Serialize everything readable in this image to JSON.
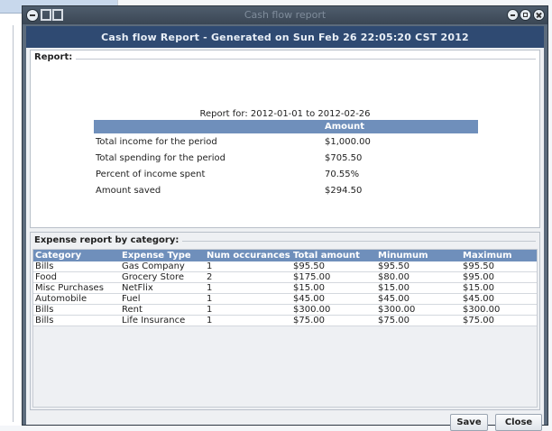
{
  "window": {
    "title": "Cash flow report",
    "header": "Cash flow Report - Generated on Sun Feb 26 22:05:20 CST 2012"
  },
  "report": {
    "legend": "Report:",
    "period": "Report for: 2012-01-01 to 2012-02-26",
    "amount_header": "Amount",
    "rows": [
      {
        "label": "Total income for the period",
        "value": "$1,000.00"
      },
      {
        "label": "Total spending for the period",
        "value": "$705.50"
      },
      {
        "label": "Percent of income spent",
        "value": "70.55%"
      },
      {
        "label": "Amount saved",
        "value": "$294.50"
      }
    ]
  },
  "expenses": {
    "legend": "Expense report by category:",
    "columns": [
      "Category",
      "Expense Type",
      "Num occurances",
      "Total amount",
      "Minumum",
      "Maximum"
    ],
    "rows": [
      [
        "Bills",
        "Gas Company",
        "1",
        "$95.50",
        "$95.50",
        "$95.50"
      ],
      [
        "Food",
        "Grocery Store",
        "2",
        "$175.00",
        "$80.00",
        "$95.00"
      ],
      [
        "Misc Purchases",
        "NetFlix",
        "1",
        "$15.00",
        "$15.00",
        "$15.00"
      ],
      [
        "Automobile",
        "Fuel",
        "1",
        "$45.00",
        "$45.00",
        "$45.00"
      ],
      [
        "Bills",
        "Rent",
        "1",
        "$300.00",
        "$300.00",
        "$300.00"
      ],
      [
        "Bills",
        "Life Insurance",
        "1",
        "$75.00",
        "$75.00",
        "$75.00"
      ]
    ]
  },
  "buttons": {
    "save": "Save",
    "close": "Close"
  },
  "colors": {
    "header_bar": "#2f4a72",
    "table_header": "#6f8fbb",
    "window_frame": "#5c6b7c"
  }
}
